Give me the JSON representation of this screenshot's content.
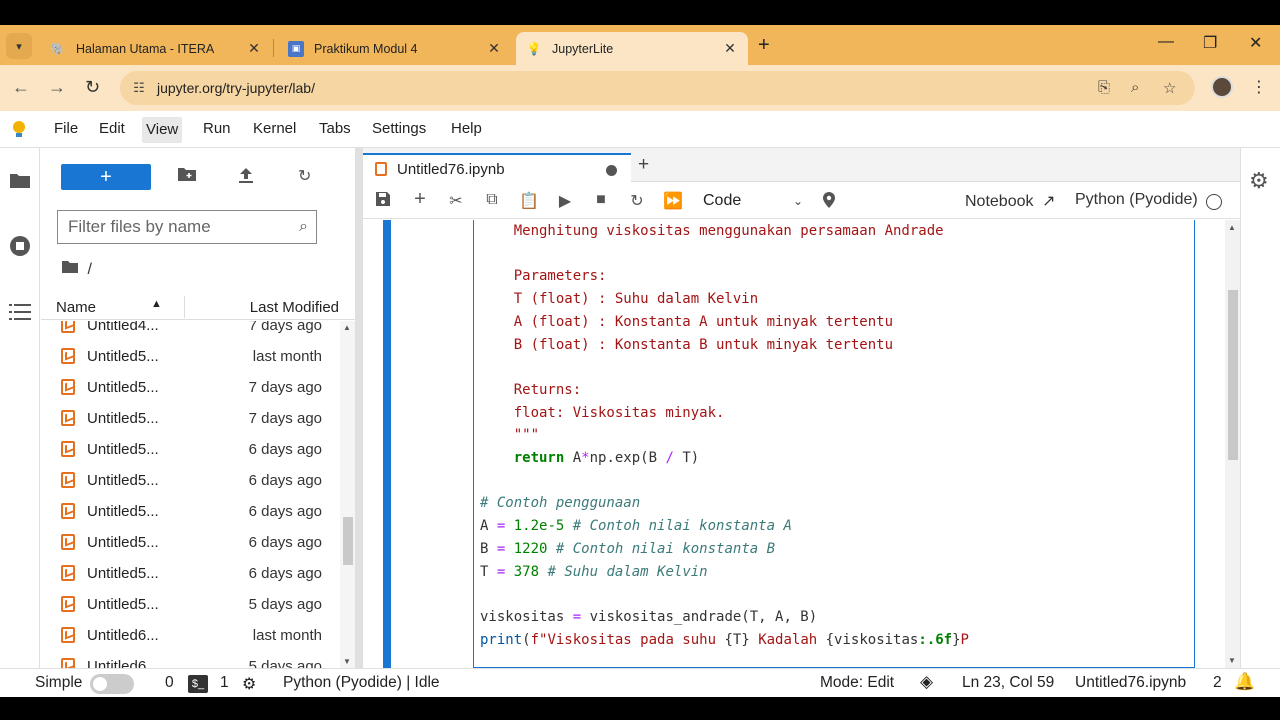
{
  "browser": {
    "tabs": [
      {
        "label": "Halaman Utama - ITERA",
        "icon": "itera-favicon"
      },
      {
        "label": "Praktikum Modul 4",
        "icon": "forms-favicon"
      },
      {
        "label": "JupyterLite",
        "icon": "jupyter-favicon"
      }
    ],
    "url": "jupyter.org/try-jupyter/lab/"
  },
  "menubar": {
    "items": [
      "File",
      "Edit",
      "View",
      "Run",
      "Kernel",
      "Tabs",
      "Settings",
      "Help"
    ]
  },
  "filebrowser": {
    "filter_placeholder": "Filter files by name",
    "path": "/",
    "col_name": "Name",
    "col_modified": "Last Modified",
    "rows": [
      {
        "name": "Untitled4...",
        "modified": "7 days ago"
      },
      {
        "name": "Untitled5...",
        "modified": "last month"
      },
      {
        "name": "Untitled5...",
        "modified": "7 days ago"
      },
      {
        "name": "Untitled5...",
        "modified": "7 days ago"
      },
      {
        "name": "Untitled5...",
        "modified": "6 days ago"
      },
      {
        "name": "Untitled5...",
        "modified": "6 days ago"
      },
      {
        "name": "Untitled5...",
        "modified": "6 days ago"
      },
      {
        "name": "Untitled5...",
        "modified": "6 days ago"
      },
      {
        "name": "Untitled5...",
        "modified": "6 days ago"
      },
      {
        "name": "Untitled5...",
        "modified": "5 days ago"
      },
      {
        "name": "Untitled6...",
        "modified": "last month"
      },
      {
        "name": "Untitled6...",
        "modified": "5 days ago"
      }
    ]
  },
  "notebook": {
    "tab_title": "Untitled76.ipynb",
    "cell_type": "Code",
    "notebook_link": "Notebook",
    "kernel_name": "Python (Pyodide)"
  },
  "statusbar": {
    "mode_label": "Simple",
    "count_a": "0",
    "count_b": "1",
    "kernel_status": "Python (Pyodide) | Idle",
    "mode": "Mode: Edit",
    "cursor": "Ln 23, Col 59",
    "filename": "Untitled76.ipynb",
    "notifications": "2"
  },
  "colors": {
    "accent": "#1976d2",
    "tab_strip": "#f2b65a",
    "toolbar": "#fbe5c4",
    "notebook_icon": "#e6701f"
  }
}
